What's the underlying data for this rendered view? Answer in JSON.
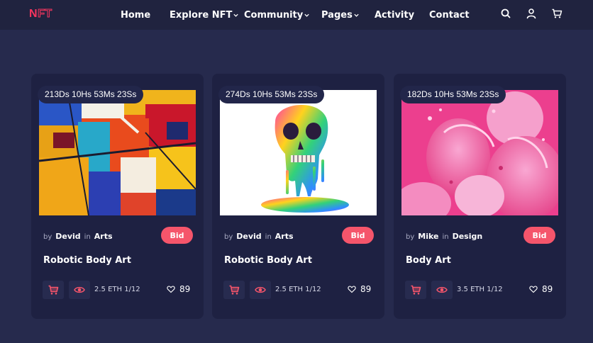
{
  "brand": {
    "logo_initial": "N",
    "logo_rest": "FT",
    "accent": "#f6355f"
  },
  "nav": {
    "items": [
      {
        "label": "Home",
        "has_dropdown": false
      },
      {
        "label": "Explore NFT",
        "has_dropdown": true
      },
      {
        "label": "Community",
        "has_dropdown": true
      },
      {
        "label": "Pages",
        "has_dropdown": true
      },
      {
        "label": "Activity",
        "has_dropdown": false
      },
      {
        "label": "Contact",
        "has_dropdown": false
      }
    ],
    "icons": [
      "search-icon",
      "user-icon",
      "cart-icon"
    ]
  },
  "cards": [
    {
      "timer": "213Ds 10Hs 53Ms 23Ss",
      "artwork": "abstract-painting",
      "by_label": "by",
      "author": "Devid",
      "in_label": "in",
      "category": "Arts",
      "bid_label": "Bid",
      "title": "Robotic Body Art",
      "price": "2.5 ETH 1/12",
      "likes": "89"
    },
    {
      "timer": "274Ds 10Hs 53Ms 23Ss",
      "artwork": "melting-rainbow-skull",
      "by_label": "by",
      "author": "Devid",
      "in_label": "in",
      "category": "Arts",
      "bid_label": "Bid",
      "title": "Robotic Body Art",
      "price": "2.5 ETH 1/12",
      "likes": "89"
    },
    {
      "timer": "182Ds 10Hs 53Ms 23Ss",
      "artwork": "pink-3d-sculpture",
      "by_label": "by",
      "author": "Mike",
      "in_label": "in",
      "category": "Design",
      "bid_label": "Bid",
      "title": "Body Art",
      "price": "3.5 ETH 1/12",
      "likes": "89"
    }
  ],
  "colors": {
    "page_bg": "#262a4d",
    "card_bg": "#1e2142",
    "bid_button": "#f5556b",
    "action_icon": "#f5556b"
  }
}
